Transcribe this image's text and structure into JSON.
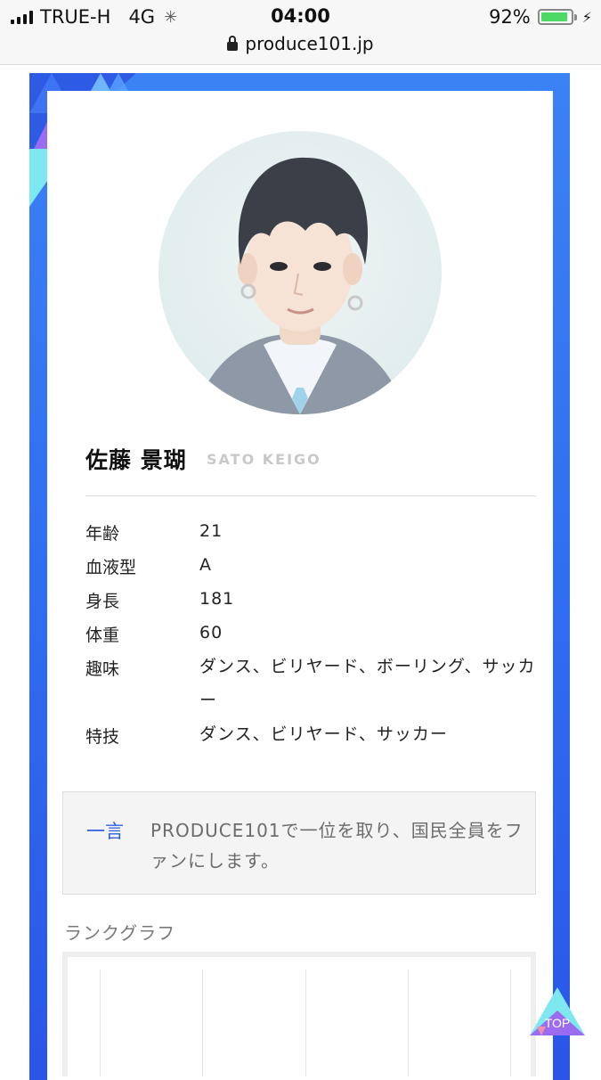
{
  "status_bar": {
    "carrier": "TRUE-H",
    "network": "4G",
    "time": "04:00",
    "battery_percent": "92%",
    "battery_level": 0.92,
    "url": "produce101.jp"
  },
  "profile": {
    "name": "佐藤 景瑚",
    "romaji": "SATO KEIGO",
    "rows": [
      {
        "label": "年齢",
        "value": "21"
      },
      {
        "label": "血液型",
        "value": "A"
      },
      {
        "label": "身長",
        "value": "181"
      },
      {
        "label": "体重",
        "value": "60"
      },
      {
        "label": "趣味",
        "value": "ダンス、ビリヤード、ボーリング、サッカー"
      },
      {
        "label": "特技",
        "value": "ダンス、ビリヤード、サッカー"
      }
    ]
  },
  "comment": {
    "label": "一言",
    "text": "PRODUCE101で一位を取り、国民全員をファンにします。"
  },
  "rank_graph": {
    "title": "ランクグラフ"
  },
  "top_button": {
    "label": "TOP"
  },
  "colors": {
    "frame_blue": "#3b82f5",
    "accent_blue": "#2f5fe0",
    "battery_green": "#4cd964",
    "deco_cyan": "#7ee8f0",
    "deco_purple": "#9b6cf0"
  }
}
